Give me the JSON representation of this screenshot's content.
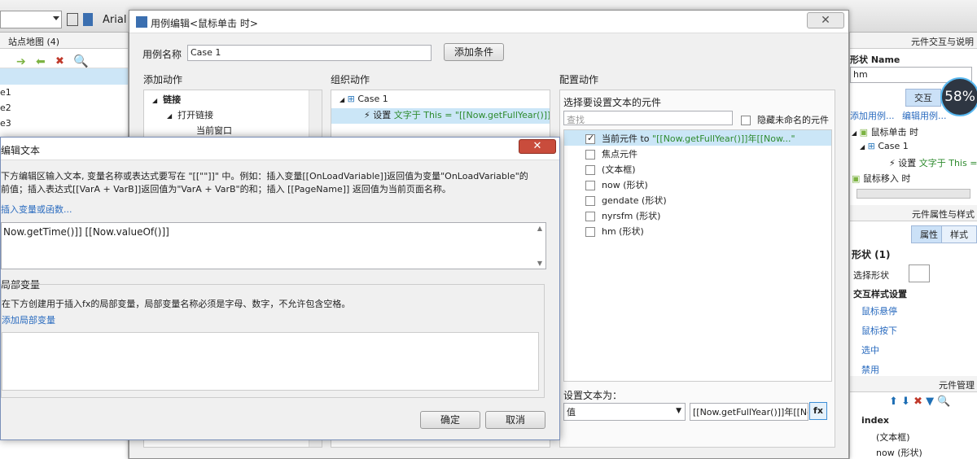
{
  "toolbar": {
    "font_name": "Arial"
  },
  "left_panel": {
    "title": "站点地图 (4)",
    "items": [
      "e1",
      "e2",
      "e3"
    ]
  },
  "case_dialog": {
    "title": "用例编辑<鼠标单击 时>",
    "case_name_label": "用例名称",
    "case_name_value": "Case 1",
    "add_condition": "添加条件",
    "col_add_action": "添加动作",
    "col_organize": "组织动作",
    "col_configure": "配置动作",
    "add_action_tree": [
      {
        "label": "链接",
        "level": 0
      },
      {
        "label": "打开链接",
        "level": 1
      },
      {
        "label": "当前窗口",
        "level": 2
      }
    ],
    "organize_tree": {
      "case": "Case 1",
      "action_prefix": "设置",
      "action_text": "文字于 This = \"[[Now.getFullYear()]]年"
    },
    "configure": {
      "select_label": "选择要设置文本的元件",
      "search_placeholder": "查找",
      "hide_unnamed": "隐藏未命名的元件",
      "widgets": [
        {
          "label": "当前元件 to",
          "extra": "\"[[Now.getFullYear()]]年[[Now...\"",
          "checked": true
        },
        {
          "label": "焦点元件",
          "extra": "",
          "checked": false
        },
        {
          "label": "(文本框)",
          "extra": "",
          "checked": false
        },
        {
          "label": "now (形状)",
          "extra": "",
          "checked": false
        },
        {
          "label": "gendate (形状)",
          "extra": "",
          "checked": false
        },
        {
          "label": "nyrsfm (形状)",
          "extra": "",
          "checked": false
        },
        {
          "label": "hm (形状)",
          "extra": "",
          "checked": false
        }
      ],
      "set_text_label": "设置文本为：",
      "value_type": "值",
      "value_text": "[[Now.getFullYear()]]年[[Now.",
      "fx": "fx"
    }
  },
  "edit_dialog": {
    "title": "编辑文本",
    "desc_line1": "下方编辑区输入文本, 变量名称或表达式要写在 \"[[\"\"]]\" 中。例如：插入变量[[OnLoadVariable]]返回值为变量\"OnLoadVariable\"的",
    "desc_line2": "前值；插入表达式[[VarA + VarB]]返回值为\"VarA + VarB\"的和；插入 [[PageName]] 返回值为当前页面名称。",
    "insert_link": "插入变量或函数...",
    "editor_text": "Now.getTime()]] [[Now.valueOf()]]",
    "local_vars_title": "局部变量",
    "local_vars_desc": "在下方创建用于插入fx的局部变量，局部变量名称必须是字母、数字，不允许包含空格。",
    "add_local_var": "添加局部变量",
    "ok": "确定",
    "cancel": "取消"
  },
  "right_panel": {
    "header": "元件交互与说明",
    "shape_name_label": "形状 Name",
    "shape_name_value": "hm",
    "tab_interact": "交互",
    "add_case": "添加用例...",
    "edit_case": "编辑用例...",
    "events": [
      "鼠标单击 时",
      "鼠标移入 时"
    ],
    "case": "Case 1",
    "action_prefix": "设置",
    "action_text": "文字于 This =",
    "props_header": "元件属性与样式",
    "tab_props": "属性",
    "tab_style": "样式",
    "shape_count": "形状 (1)",
    "select_shape": "选择形状",
    "interaction_styles": "交互样式设置",
    "styles": [
      "鼠标悬停",
      "鼠标按下",
      "选中",
      "禁用"
    ],
    "manager_header": "元件管理",
    "manager_items": [
      "index",
      "(文本框)",
      "now (形状)"
    ]
  },
  "clock": {
    "value": "58%"
  }
}
